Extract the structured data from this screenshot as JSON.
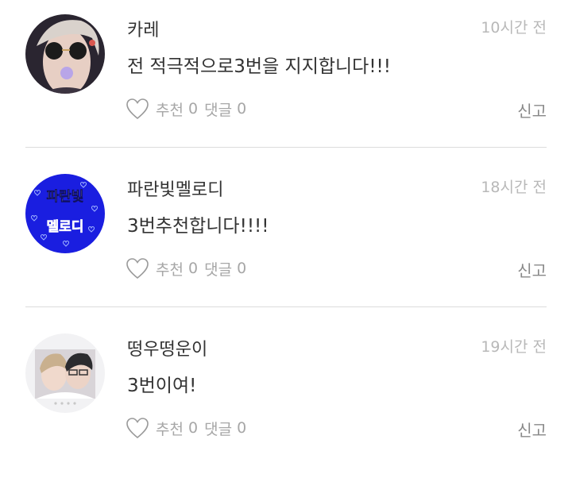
{
  "comments": [
    {
      "username": "카레",
      "time": "10시간 전",
      "text": "전 적극적으로3번을 지지합니다!!!",
      "like_label": "추천",
      "like_count": "0",
      "reply_label": "댓글",
      "reply_count": "0",
      "report_label": "신고"
    },
    {
      "username": "파란빛멜로디",
      "time": "18시간 전",
      "text": "3번추천합니다!!!!",
      "like_label": "추천",
      "like_count": "0",
      "reply_label": "댓글",
      "reply_count": "0",
      "report_label": "신고",
      "avatar_text": [
        "파란빛",
        "멜로디"
      ]
    },
    {
      "username": "떵우떵운이",
      "time": "19시간 전",
      "text": "3번이여!",
      "like_label": "추천",
      "like_count": "0",
      "reply_label": "댓글",
      "reply_count": "0",
      "report_label": "신고"
    }
  ],
  "colors": {
    "text": "#333333",
    "meta": "#a7a7a7",
    "divider": "#dcdcdc"
  }
}
